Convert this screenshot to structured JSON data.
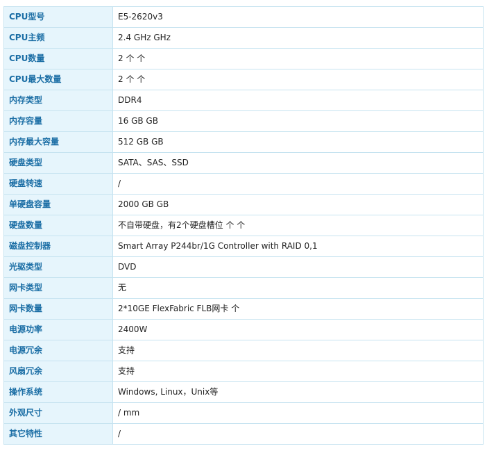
{
  "specs": [
    {
      "label": "CPU型号",
      "value": "E5-2620v3"
    },
    {
      "label": "CPU主频",
      "value": "2.4 GHz  GHz"
    },
    {
      "label": "CPU数量",
      "value": "2 个  个"
    },
    {
      "label": "CPU最大数量",
      "value": "2 个  个"
    },
    {
      "label": "内存类型",
      "value": "DDR4"
    },
    {
      "label": "内存容量",
      "value": "16 GB  GB"
    },
    {
      "label": "内存最大容量",
      "value": "512 GB  GB"
    },
    {
      "label": "硬盘类型",
      "value": "SATA、SAS、SSD"
    },
    {
      "label": "硬盘转速",
      "value": "/"
    },
    {
      "label": "单硬盘容量",
      "value": "2000 GB  GB"
    },
    {
      "label": "硬盘数量",
      "value": "不自带硬盘，有2个硬盘槽位 个  个"
    },
    {
      "label": "磁盘控制器",
      "value": "Smart Array P244br/1G Controller with RAID 0,1"
    },
    {
      "label": "光驱类型",
      "value": "DVD"
    },
    {
      "label": "网卡类型",
      "value": "无"
    },
    {
      "label": "网卡数量",
      "value": "2*10GE FlexFabric FLB网卡  个"
    },
    {
      "label": "电源功率",
      "value": "2400W"
    },
    {
      "label": "电源冗余",
      "value": "支持"
    },
    {
      "label": "风扇冗余",
      "value": "支持"
    },
    {
      "label": "操作系统",
      "value": "Windows, Linux，Unix等"
    },
    {
      "label": "外观尺寸",
      "value": "/  mm"
    },
    {
      "label": "其它特性",
      "value": "/"
    }
  ],
  "colors": {
    "label_text": "#1b6ea5",
    "label_bg": "#e6f5fc",
    "border": "#c6e3f0",
    "value_text": "#222222"
  }
}
